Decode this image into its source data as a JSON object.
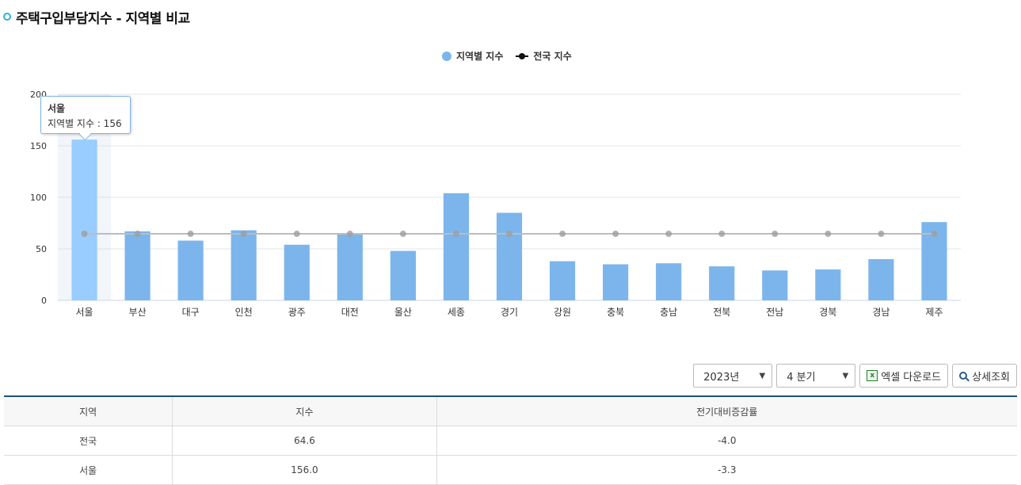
{
  "page": {
    "title": "주택구입부담지수 - 지역별 비교"
  },
  "legend": {
    "bar_label": "지역별 지수",
    "line_label": "전국 지수"
  },
  "tooltip": {
    "title": "서울",
    "text": "지역별 지수 : 156"
  },
  "controls": {
    "year": "2023년",
    "quarter": "4 분기",
    "excel_label": "엑셀 다운로드",
    "detail_label": "상세조회"
  },
  "table": {
    "headers": [
      "지역",
      "지수",
      "전기대비증감률"
    ],
    "rows": [
      [
        "전국",
        "64.6",
        "-4.0"
      ],
      [
        "서울",
        "156.0",
        "-3.3"
      ]
    ]
  },
  "colors": {
    "bar": "#7cb5ec",
    "bar_hover": "#99ccff",
    "line": "#bdbdbd",
    "accent": "#2bb3d9",
    "table_border": "#1f4f7a"
  },
  "chart_data": {
    "type": "bar",
    "categories": [
      "서울",
      "부산",
      "대구",
      "인천",
      "광주",
      "대전",
      "울산",
      "세종",
      "경기",
      "강원",
      "충북",
      "충남",
      "전북",
      "전남",
      "경북",
      "경남",
      "제주"
    ],
    "series": [
      {
        "name": "지역별 지수",
        "type": "bar",
        "values": [
          156,
          67,
          58,
          68,
          54,
          65,
          48,
          104,
          85,
          38,
          35,
          36,
          33,
          29,
          30,
          40,
          76
        ]
      },
      {
        "name": "전국 지수",
        "type": "line",
        "values": [
          64.6,
          64.6,
          64.6,
          64.6,
          64.6,
          64.6,
          64.6,
          64.6,
          64.6,
          64.6,
          64.6,
          64.6,
          64.6,
          64.6,
          64.6,
          64.6,
          64.6
        ]
      }
    ],
    "yticks": [
      0,
      50,
      100,
      150,
      200
    ],
    "ylim": [
      0,
      200
    ],
    "grid": true,
    "legend_position": "top-center",
    "highlighted_category": "서울"
  }
}
